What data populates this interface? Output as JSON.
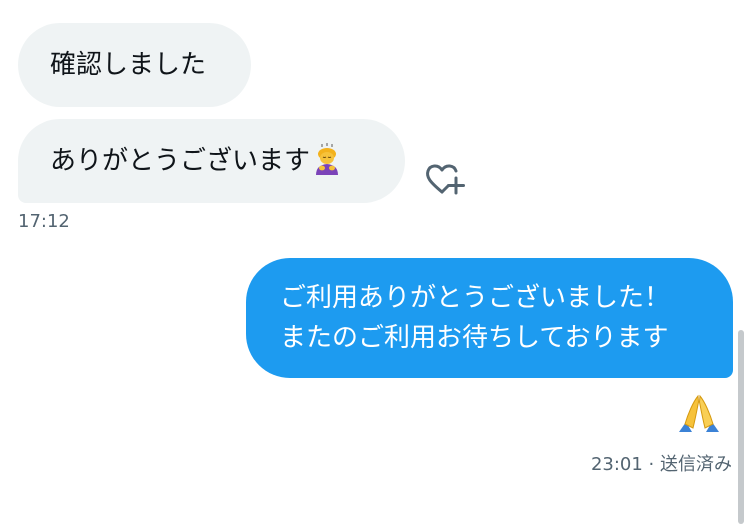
{
  "messages": {
    "incoming_1": {
      "text": "確認しました"
    },
    "incoming_2": {
      "text": "ありがとうございます",
      "emoji": "person-bowing-emoji"
    },
    "incoming_time": "17:12",
    "outgoing_1": {
      "line1": "ご利用ありがとうございました！",
      "line2": "またのご利用お待ちしております"
    },
    "outgoing_reaction_emoji": "folded-hands-emoji",
    "outgoing_time": "23:01",
    "outgoing_status": " · 送信済み"
  },
  "icons": {
    "react": "heart-plus-icon"
  },
  "colors": {
    "incoming_bubble": "#eff3f4",
    "outgoing_bubble": "#1d9bf0",
    "meta_text": "#536471"
  }
}
